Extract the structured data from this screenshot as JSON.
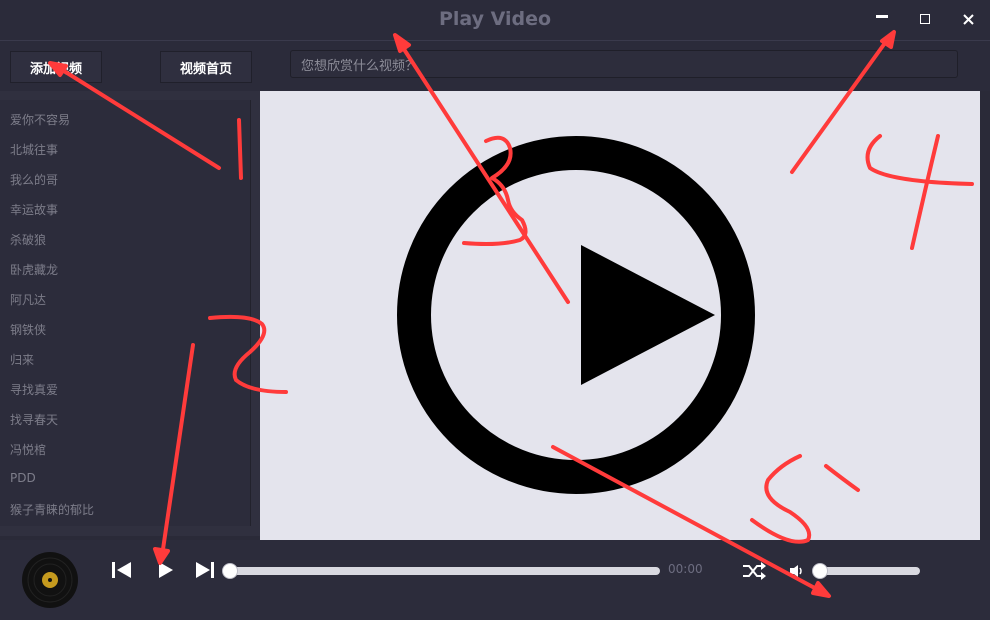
{
  "window": {
    "title": "Play Video",
    "controls": [
      "minimize",
      "maximize",
      "close"
    ]
  },
  "toolbar": {
    "add_video_label": "添加视频",
    "home_label": "视频首页",
    "search_placeholder": "您想欣赏什么视频？"
  },
  "playlist": {
    "items": [
      "爱你不容易",
      "北城往事",
      "我么的哥",
      "幸运故事",
      "杀破狼",
      "卧虎藏龙",
      "阿凡达",
      "钢铁侠",
      "归来",
      "寻找真爱",
      "找寻春天",
      "冯悦棺",
      "PDD",
      "猴子青睐的郁比"
    ]
  },
  "player": {
    "current_time": "00:00",
    "progress_fraction": 0.0,
    "volume_fraction": 0.0
  },
  "annotations": {
    "labels": [
      "1",
      "2",
      "3",
      "4",
      "5"
    ]
  },
  "colors": {
    "bg": "#2a2a38",
    "video_bg": "#e4e4ed",
    "annotation": "#ff3b3b"
  }
}
